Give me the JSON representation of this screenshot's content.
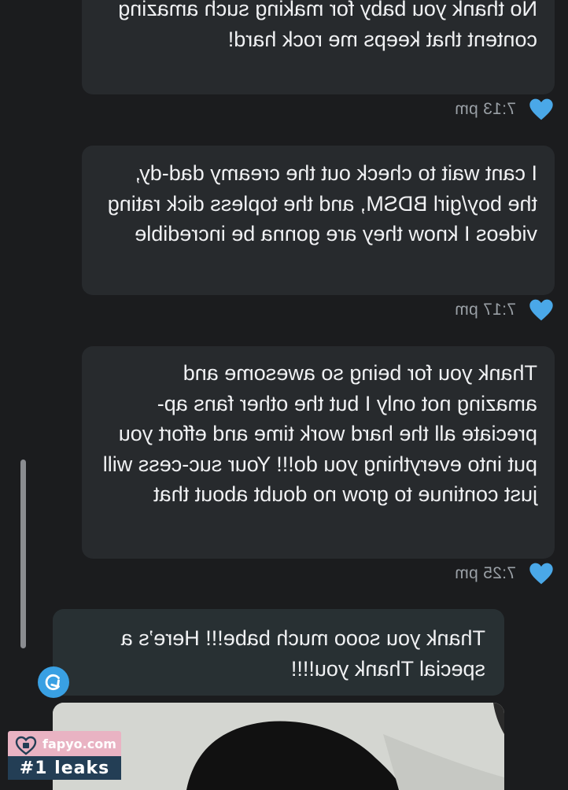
{
  "messages": [
    {
      "type": "sent",
      "text": "No thank you baby for making such amazing content that keeps me rock hard!",
      "time": "7:13 pm"
    },
    {
      "type": "sent",
      "text": "I cant wait to check out the creamy dad-dy, the boy/girl BDSM, and the topless dick rating videos I know they are gonna be incredible",
      "time": "7:17 pm"
    },
    {
      "type": "sent",
      "text": "Thank you for being so awesome and amazing not only I but the other fans ap-preciate all the hard work time and effort you put into everything you do!!! Your suc-cess will just continue to grow no doubt about that",
      "time": "7:25 pm"
    },
    {
      "type": "received",
      "text": "Thank you sooo much babe!!! Here’s a special Thank you!!!!"
    }
  ],
  "watermark": {
    "site": "fapyo.com",
    "tagline": "#1 leaks"
  },
  "colors": {
    "background": "#1b1c1e",
    "sent_bubble": "#272a2d",
    "received_bubble": "#283033",
    "heart": "#4aa8e8",
    "accent": "#39a0e3"
  },
  "icons": {
    "like": "heart-icon",
    "reply": "reply-arrow-icon"
  }
}
